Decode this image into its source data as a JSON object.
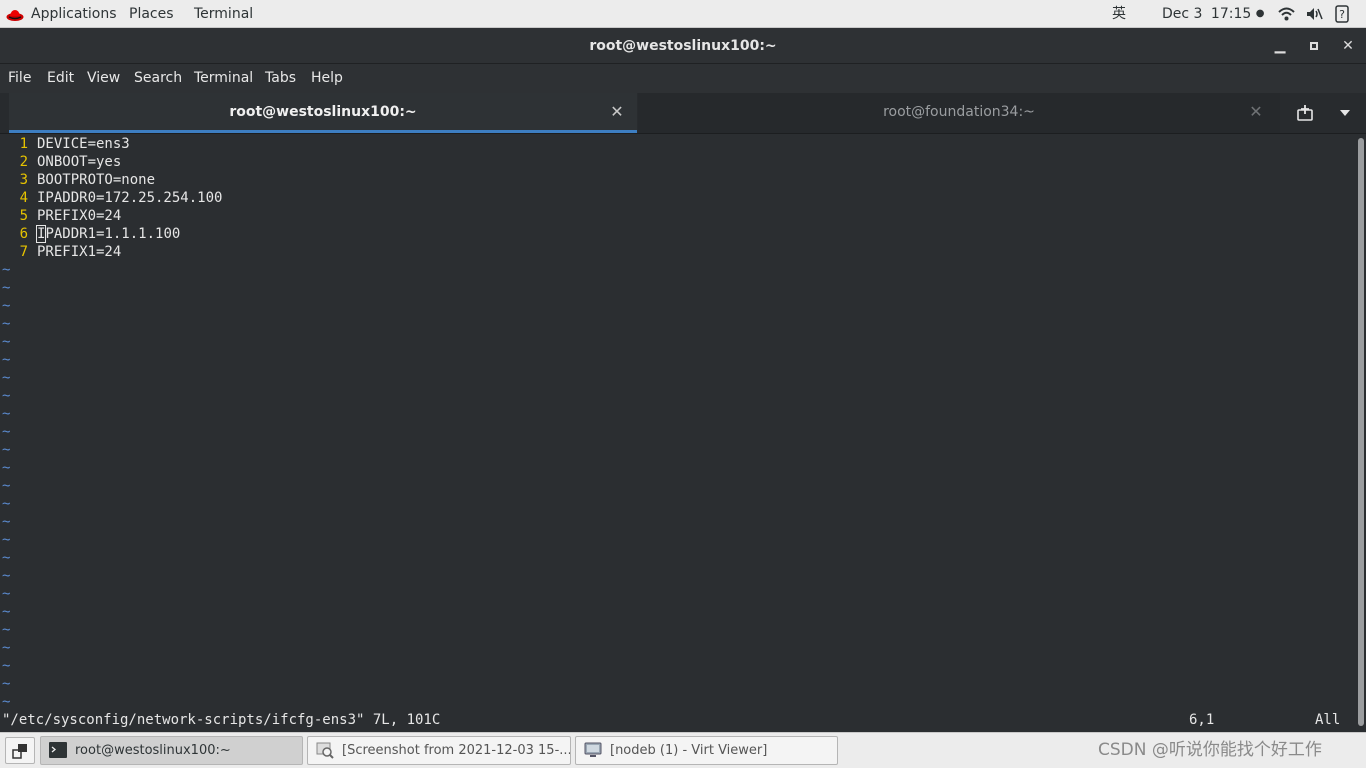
{
  "top_panel": {
    "applications": "Applications",
    "places": "Places",
    "terminal": "Terminal",
    "input_method": "英",
    "date": "Dec 3",
    "time": "17:15"
  },
  "window": {
    "title": "root@westoslinux100:~"
  },
  "menu": [
    "File",
    "Edit",
    "View",
    "Search",
    "Terminal",
    "Tabs",
    "Help"
  ],
  "tabs": [
    {
      "label": "root@westoslinux100:~",
      "active": true
    },
    {
      "label": "root@foundation34:~",
      "active": false
    }
  ],
  "editor": {
    "lines": [
      {
        "num": "1",
        "text": "DEVICE=ens3"
      },
      {
        "num": "2",
        "text": "ONBOOT=yes"
      },
      {
        "num": "3",
        "text": "BOOTPROTO=none"
      },
      {
        "num": "4",
        "text": "IPADDR0=172.25.254.100"
      },
      {
        "num": "5",
        "text": "PREFIX0=24"
      },
      {
        "num": "6",
        "text": "IPADDR1=1.1.1.100",
        "cursor_char": "I",
        "rest": "PADDR1=1.1.1.100"
      },
      {
        "num": "7",
        "text": "PREFIX1=24"
      }
    ],
    "tilde": "~",
    "status_file": "\"/etc/sysconfig/network-scripts/ifcfg-ens3\" 7L, 101C",
    "status_position": "6,1",
    "status_scroll": "All"
  },
  "taskbar": {
    "items": [
      {
        "label": "root@westoslinux100:~",
        "active": true
      },
      {
        "label": "[Screenshot from 2021-12-03 15-...",
        "active": false
      },
      {
        "label": "[nodeb (1) - Virt Viewer]",
        "active": false
      }
    ],
    "watermark": "CSDN @听说你能找个好工作"
  },
  "colors": {
    "line_number": "#e6c300",
    "tilde": "#5b8bd0",
    "tab_accent": "#3d7ec2",
    "terminal_bg": "#2b2e31"
  },
  "icons": [
    "redhat-icon",
    "wifi-icon",
    "volume-icon",
    "power-icon",
    "new-tab-icon",
    "tab-menu-icon",
    "show-desktop-icon",
    "terminal-icon",
    "screenshot-viewer-icon",
    "virt-viewer-icon"
  ]
}
